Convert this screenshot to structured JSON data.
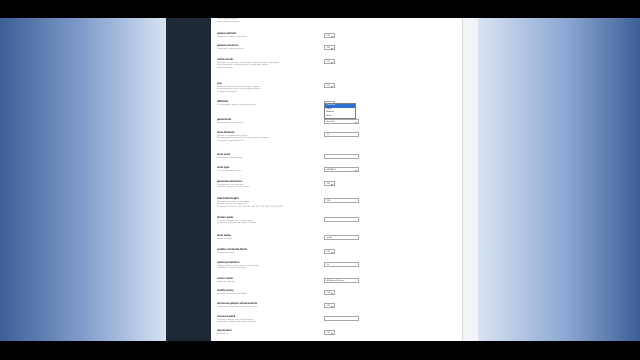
{
  "properties": [
    {
      "name": "allow-nether",
      "description": "Позволяет игрокам путешествовать в Незер.\nTrue - Незер включен.\nFalse - Незер отключен.",
      "control": "select",
      "value": "ON"
    },
    {
      "name": "spawn-animals",
      "description": "Позволяет спавнить животных.",
      "control": "select",
      "value": "ON"
    },
    {
      "name": "spawn-monsters",
      "description": "Позволяет спавнить мобов.",
      "control": "select",
      "value": "ON"
    },
    {
      "name": "online-mode",
      "description": "Проверять ли учетную запись игрока через сервер авторизации.\nЕсли включено, то только игроки с лицензией смогут\nзайти на сервер.",
      "control": "select",
      "value": "ON"
    },
    {
      "name": "pvp",
      "description": "Позволяет игрокам сражаться друг с другом.\nЕсли выключено, урон от атак другого игрока\nне будет наноситься.",
      "control": "select",
      "value": "ON"
    },
    {
      "name": "difficulty",
      "description": "Устанавливает уровень сложности игры.",
      "control": "select",
      "value": "Normal"
    },
    {
      "name": "gamemode",
      "description": "Режим игры по умолчанию.",
      "control": "select",
      "value": "Survival"
    },
    {
      "name": "view-distance",
      "description": "Дальность прорисовки в чанках.\nРекомендуемое значение 8-10 для среднего сервера.\nЗначение по умолчанию 10.",
      "control": "text",
      "value": "10"
    },
    {
      "name": "level-seed",
      "description": "Ключ для генерации мира.",
      "control": "text",
      "value": ""
    },
    {
      "name": "level-type",
      "description": "Тип генерируемого мира.",
      "control": "select",
      "value": "DEFAULT"
    },
    {
      "name": "generate-structures",
      "description": "Генерировать ли структуры\n(деревни, крепости и т.д.) в мире.",
      "control": "select",
      "value": "ON"
    },
    {
      "name": "max-build-height",
      "description": "Максимальная высота постройки.\nВысота должна быть кратна 16.\nЗначения: 64, 80, 96, 112, 128, 144, 160, 176, 192, 208, 224, 240, 256.",
      "control": "text",
      "value": "256"
    },
    {
      "name": "texture-pack",
      "description": "Ссылка на ресурс-пак, который будет\nпредложен игрокам при входе на сервер.",
      "control": "text",
      "value": ""
    },
    {
      "name": "level-name",
      "description": "Название мира.",
      "control": "text",
      "value": "world"
    },
    {
      "name": "enable-command-block",
      "description": "Командные блоки.",
      "control": "select",
      "value": "ON"
    },
    {
      "name": "spawn-protection",
      "description": "Радиус защиты точки спавна от изменений\nигроками без прав оператора.",
      "control": "text",
      "value": "16"
    },
    {
      "name": "server-name",
      "description": "Название сервера.",
      "control": "text",
      "value": "A Minecraft Server"
    },
    {
      "name": "enable-query",
      "description": "Включает протокол GameSpy4.",
      "control": "select",
      "value": "OFF"
    },
    {
      "name": "announce-player-achievements",
      "description": "Объявлять ли достижения игроков в чате.",
      "control": "select",
      "value": "ON"
    },
    {
      "name": "resource-pack",
      "description": "Ссылка на ресурс-пак, который будет\nпредложен игрокам при входе на сервер.",
      "control": "text",
      "value": ""
    },
    {
      "name": "pvp-broken",
      "description": "Выключено.",
      "control": "select",
      "value": "ON"
    }
  ],
  "difficulty_dropdown": {
    "options": [
      "Peaceful",
      "Easy",
      "Normal",
      "Hard"
    ],
    "highlighted": "Peaceful"
  }
}
